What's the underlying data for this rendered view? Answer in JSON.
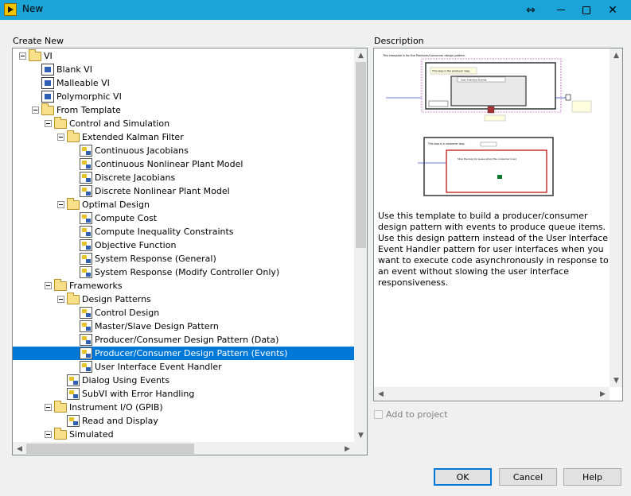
{
  "window": {
    "title": "New"
  },
  "left_panel": {
    "label": "Create New",
    "tree": [
      {
        "label": "VI",
        "depth": 0,
        "icon": "folder-open-icon",
        "expander": true
      },
      {
        "label": "Blank VI",
        "depth": 1,
        "icon": "vi-icon",
        "expander": false
      },
      {
        "label": "Malleable VI",
        "depth": 1,
        "icon": "vi-icon",
        "expander": false
      },
      {
        "label": "Polymorphic VI",
        "depth": 1,
        "icon": "vi-icon",
        "expander": false
      },
      {
        "label": "From Template",
        "depth": 1,
        "icon": "folder-open-icon",
        "expander": true
      },
      {
        "label": "Control and Simulation",
        "depth": 2,
        "icon": "folder-open-icon",
        "expander": true
      },
      {
        "label": "Extended Kalman Filter",
        "depth": 3,
        "icon": "folder-open-icon",
        "expander": true
      },
      {
        "label": "Continuous Jacobians",
        "depth": 4,
        "icon": "template-icon",
        "expander": false
      },
      {
        "label": "Continuous Nonlinear Plant Model",
        "depth": 4,
        "icon": "template-icon",
        "expander": false
      },
      {
        "label": "Discrete Jacobians",
        "depth": 4,
        "icon": "template-icon",
        "expander": false
      },
      {
        "label": "Discrete Nonlinear Plant Model",
        "depth": 4,
        "icon": "template-icon",
        "expander": false
      },
      {
        "label": "Optimal Design",
        "depth": 3,
        "icon": "folder-open-icon",
        "expander": true
      },
      {
        "label": "Compute Cost",
        "depth": 4,
        "icon": "template-icon",
        "expander": false
      },
      {
        "label": "Compute Inequality Constraints",
        "depth": 4,
        "icon": "template-icon",
        "expander": false
      },
      {
        "label": "Objective Function",
        "depth": 4,
        "icon": "template-icon",
        "expander": false
      },
      {
        "label": "System Response (General)",
        "depth": 4,
        "icon": "template-icon",
        "expander": false
      },
      {
        "label": "System Response (Modify Controller Only)",
        "depth": 4,
        "icon": "template-icon",
        "expander": false
      },
      {
        "label": "Frameworks",
        "depth": 2,
        "icon": "folder-open-icon",
        "expander": true
      },
      {
        "label": "Design Patterns",
        "depth": 3,
        "icon": "folder-open-icon",
        "expander": true
      },
      {
        "label": "Control Design",
        "depth": 4,
        "icon": "template-icon",
        "expander": false
      },
      {
        "label": "Master/Slave Design Pattern",
        "depth": 4,
        "icon": "template-icon",
        "expander": false
      },
      {
        "label": "Producer/Consumer Design Pattern (Data)",
        "depth": 4,
        "icon": "template-icon",
        "expander": false
      },
      {
        "label": "Producer/Consumer Design Pattern (Events)",
        "depth": 4,
        "icon": "template-icon",
        "expander": false,
        "selected": true
      },
      {
        "label": "User Interface Event Handler",
        "depth": 4,
        "icon": "template-icon",
        "expander": false
      },
      {
        "label": "Dialog Using Events",
        "depth": 3,
        "icon": "template-icon",
        "expander": false
      },
      {
        "label": "SubVI with Error Handling",
        "depth": 3,
        "icon": "template-icon",
        "expander": false
      },
      {
        "label": "Instrument I/O (GPIB)",
        "depth": 2,
        "icon": "folder-open-icon",
        "expander": true
      },
      {
        "label": "Read and Display",
        "depth": 3,
        "icon": "template-icon",
        "expander": false
      },
      {
        "label": "Simulated",
        "depth": 2,
        "icon": "folder-open-icon",
        "expander": true
      }
    ]
  },
  "right_panel": {
    "label": "Description",
    "preview_caption": "This template is for the Producer/Consumer design pattern.",
    "preview_producer": "This loop is the producer loop.",
    "preview_consumer": "This loop is a consumer loop.",
    "preview_event": "User Interface Events",
    "preview_note": "Stop the loop by queue stop (the consumer loop)",
    "description": "Use this template to build a producer/consumer design pattern with events to produce queue items. Use this design pattern instead of the User Interface Event Handler pattern for user interfaces when you want to execute code asynchronously in response to an event without slowing the user interface responsiveness."
  },
  "add_to_project": {
    "label": "Add to project",
    "checked": false,
    "enabled": false
  },
  "buttons": {
    "ok": "OK",
    "cancel": "Cancel",
    "help": "Help"
  },
  "colors": {
    "titlebar": "#1aa4d8",
    "selection": "#0078d7"
  }
}
